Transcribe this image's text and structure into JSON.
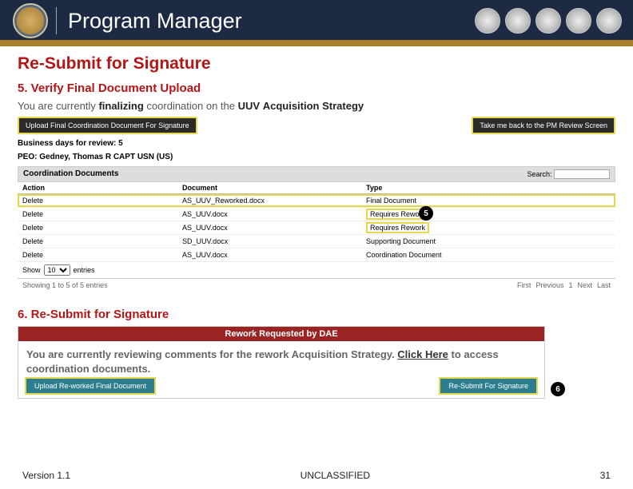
{
  "header": {
    "title": "Program Manager"
  },
  "h1": "Re-Submit for Signature",
  "step5": {
    "heading": "5. Verify Final Document Upload",
    "sentence_pre": "You are currently",
    "sentence_act": "finalizing",
    "sentence_mid": "coordination on the",
    "sentence_prog": "UUV",
    "sentence_post": "Acquisition Strategy",
    "upload_btn": "Upload Final Coordination Document For Signature",
    "back_btn": "Take me back to the PM Review Screen",
    "biz_days": "Business days for review: 5",
    "peo": "PEO: Gedney, Thomas R CAPT USN (US)",
    "coord_header": "Coordination Documents",
    "search_label": "Search:",
    "cols": {
      "action": "Action",
      "document": "Document",
      "type": "Type"
    },
    "rows": [
      {
        "action": "Delete",
        "doc": "AS_UUV_Reworked.docx",
        "type": "Final Document",
        "hl": true
      },
      {
        "action": "Delete",
        "doc": "AS_UUV.docx",
        "type": "Requires Rework",
        "hlcell": true
      },
      {
        "action": "Delete",
        "doc": "AS_UUV.docx",
        "type": "Requires Rework",
        "hlcell": true
      },
      {
        "action": "Delete",
        "doc": "SD_UUV.docx",
        "type": "Supporting Document"
      },
      {
        "action": "Delete",
        "doc": "AS_UUV.docx",
        "type": "Coordination Document"
      }
    ],
    "show_pre": "Show",
    "show_post": "entries",
    "show_opt": "10",
    "showing": "Showing 1 to 5 of 5 entries",
    "pager": [
      "First",
      "Previous",
      "1",
      "Next",
      "Last"
    ],
    "callout": "5"
  },
  "step6": {
    "heading": "6. Re-Submit for Signature",
    "bar": "Rework Requested by DAE",
    "txt1": "You are currently reviewing comments for the rework Acquisition Strategy.",
    "txt2a": "Click Here",
    "txt2b": " to access coordination documents.",
    "upload_btn": "Upload Re-worked Final Document",
    "resubmit_btn": "Re-Submit For Signature",
    "callout": "6"
  },
  "footer": {
    "version": "Version 1.1",
    "classification": "UNCLASSIFIED",
    "page": "31"
  }
}
